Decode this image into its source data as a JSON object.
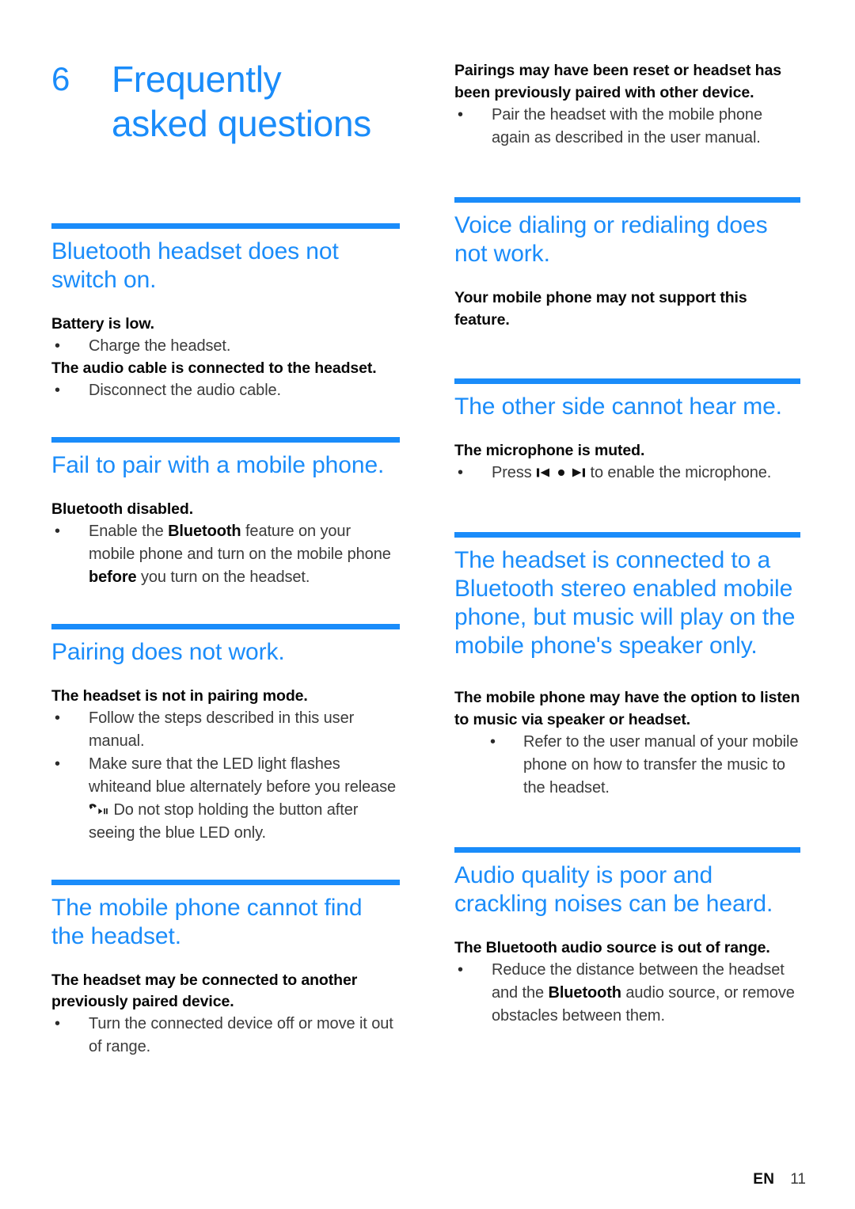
{
  "chapter": {
    "number": "6",
    "title_line1": "Frequently",
    "title_line2": "asked questions"
  },
  "colors": {
    "accent": "#1a8cfa",
    "body_text": "#3b3b3b",
    "bold_text": "#0a0a0a"
  },
  "left_column": {
    "sections": [
      {
        "heading": "Bluetooth headset does not switch on.",
        "cause1": "Battery is low.",
        "fix1": "Charge the headset.",
        "cause2": "The audio cable is connected to the headset.",
        "fix2": "Disconnect the audio cable."
      },
      {
        "heading": "Fail to pair with a mobile phone.",
        "cause1": "Bluetooth disabled.",
        "fix1_a": "Enable the ",
        "fix1_b": "Bluetooth",
        "fix1_c": " feature on your mobile phone and turn on the mobile phone ",
        "fix1_d": "before",
        "fix1_e": " you turn on the headset."
      },
      {
        "heading": "Pairing does not work.",
        "cause1": "The headset is not in pairing mode.",
        "fix1": "Follow the steps described in this user manual.",
        "fix2_a": "Make sure that the LED light flashes whiteand blue alternately before you release ",
        "fix2_icon": "phone-playpause-icon",
        "fix2_b": " Do not stop holding the button after seeing the blue LED only."
      },
      {
        "heading": "The mobile phone cannot find the headset.",
        "cause1": "The headset may be connected to another previously paired device.",
        "fix1": "Turn the connected device off or move it out of range."
      }
    ]
  },
  "right_column": {
    "continued": {
      "cause": "Pairings may have been reset or headset has been previously paired with other device.",
      "fix": "Pair the headset with the mobile phone again as described in the user manual."
    },
    "sections": [
      {
        "heading": "Voice dialing or redialing does not work.",
        "cause1": "Your mobile phone may not support this feature."
      },
      {
        "heading": "The other side cannot hear me.",
        "cause1": "The microphone is muted.",
        "fix1_a": "Press ",
        "fix1_icon_prev": "previous-track-icon",
        "fix1_icon_dot": "dot-icon",
        "fix1_icon_next": "next-track-icon",
        "fix1_b": " to enable the microphone."
      },
      {
        "heading": "The headset is connected to a Bluetooth stereo enabled mobile phone, but music will play on the mobile phone's speaker only.",
        "cause1": "The mobile phone may have the option to listen to music via speaker or headset.",
        "fix1": "Refer to the user manual of your mobile phone on how to transfer the music to the headset."
      },
      {
        "heading": "Audio quality is poor and crackling noises can be heard.",
        "cause1": "The Bluetooth audio source is out of range.",
        "fix1_a": "Reduce the distance between the headset and the ",
        "fix1_b": "Bluetooth",
        "fix1_c": " audio source, or remove obstacles between them."
      }
    ]
  },
  "footer": {
    "language": "EN",
    "page_number": "11"
  }
}
